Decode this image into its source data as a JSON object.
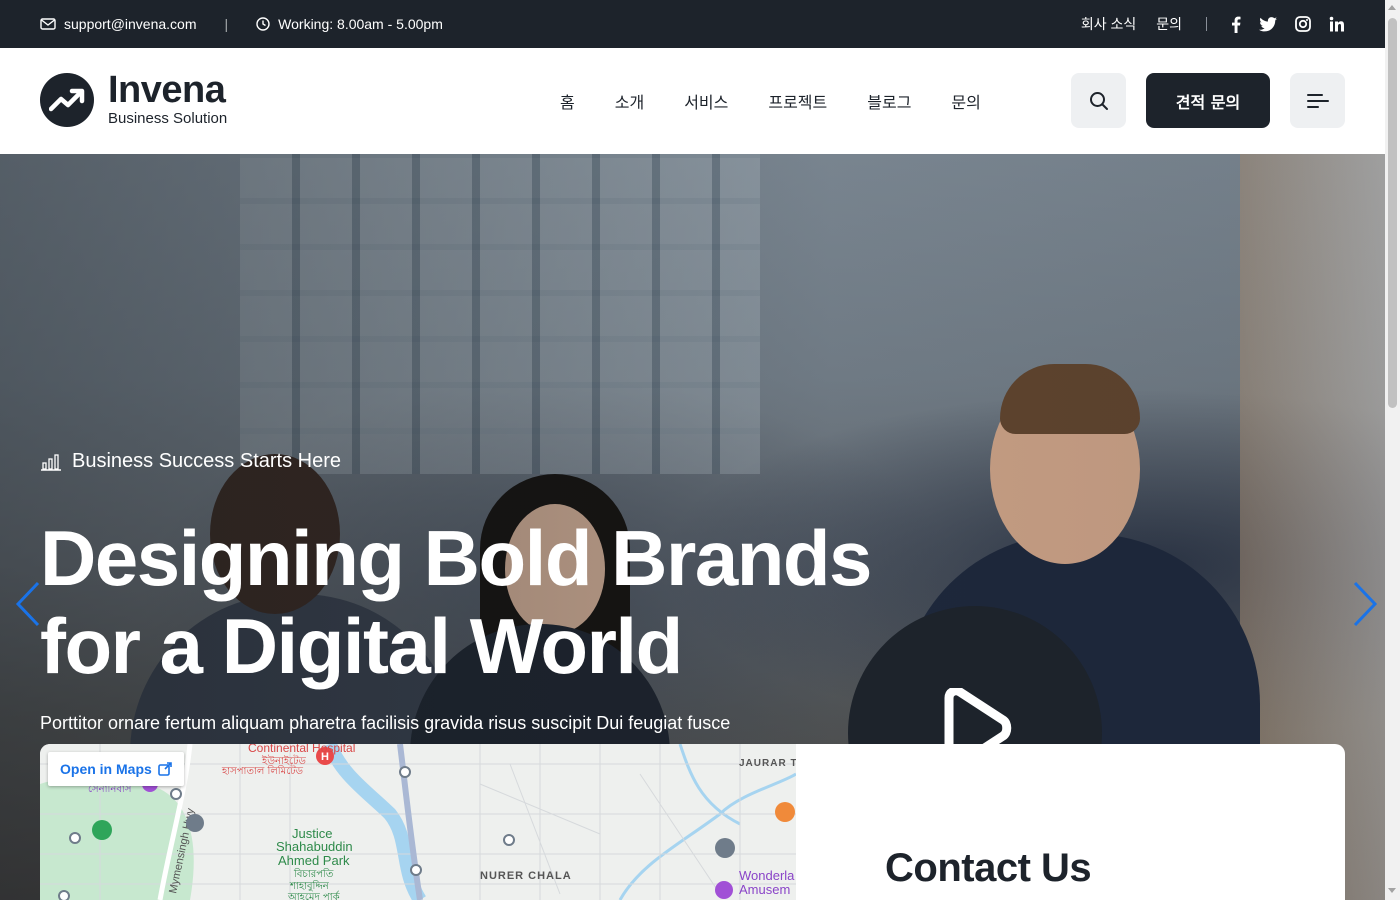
{
  "topbar": {
    "email": "support@invena.com",
    "hours": "Working: 8.00am - 5.00pm",
    "links": [
      "회사 소식",
      "문의"
    ],
    "social_icons": [
      "facebook-icon",
      "twitter-icon",
      "instagram-icon",
      "linkedin-icon"
    ]
  },
  "header": {
    "logo_name": "Invena",
    "logo_sub": "Business Solution",
    "nav": [
      "홈",
      "소개",
      "서비스",
      "프로젝트",
      "블로그",
      "문의"
    ],
    "quote_button": "견적 문의"
  },
  "hero": {
    "tagline": "Business Success Starts Here",
    "headline_line1": "Designing Bold Brands",
    "headline_line2": "for a Digital World",
    "subtext": "Porttitor ornare fertum aliquam pharetra facilisis gravida risus suscipit Dui feugiat fusce"
  },
  "map": {
    "open_button": "Open in Maps",
    "labels": {
      "hospital": "Continental Hospital",
      "hospital_bn1": "ইউনাইটেড",
      "hospital_bn2": "হাসপাতাল লিমিটেড",
      "area1": "সেনানিবাস",
      "park1": "Justice",
      "park2": "Shahabuddin",
      "park3": "Ahmed Park",
      "park_bn1": "বিচারপতি",
      "park_bn2": "শাহাবুদ্দিন",
      "park_bn3": "আহমেদ পার্ক",
      "road": "Mymensingh Hwy",
      "jaurar": "JAURAR TI",
      "nurer": "NURER CHALA",
      "wonder1": "Wonderla",
      "wonder2": "Amusem"
    }
  },
  "contact": {
    "title": "Contact Us"
  },
  "colors": {
    "dark": "#1d232b",
    "accent_blue": "#1a73e8"
  }
}
